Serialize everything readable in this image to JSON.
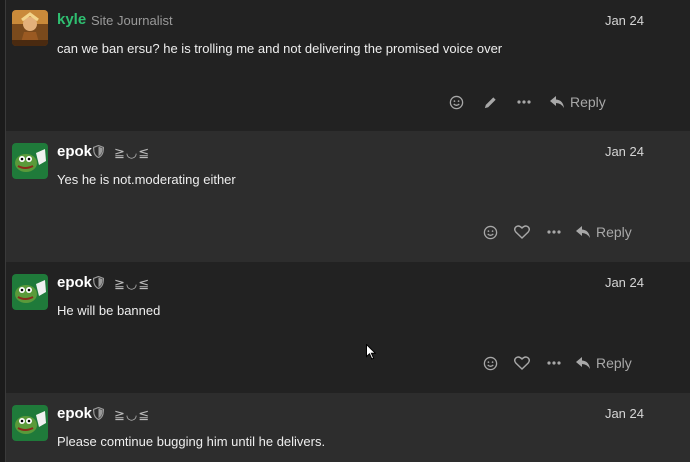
{
  "posts": [
    {
      "username": "kyle",
      "user_title": "Site Journalist",
      "date": "Jan 24",
      "text": "can we ban ersu? he is trolling me and not delivering the promised voice over",
      "reply_label": "Reply",
      "name_color": "#2fbf71",
      "actions": [
        "smile-icon",
        "edit-icon",
        "more-icon"
      ]
    },
    {
      "username": "epok",
      "emoticon": "≧◡≦",
      "date": "Jan 24",
      "text": "Yes he is not.moderating either",
      "reply_label": "Reply",
      "name_color": "#ffffff",
      "actions": [
        "smile-icon",
        "heart-icon",
        "more-icon"
      ]
    },
    {
      "username": "epok",
      "emoticon": "≧◡≦",
      "date": "Jan 24",
      "text": "He will be banned",
      "reply_label": "Reply",
      "name_color": "#ffffff",
      "actions": [
        "smile-icon",
        "heart-icon",
        "more-icon"
      ]
    },
    {
      "username": "epok",
      "emoticon": "≧◡≦",
      "date": "Jan 24",
      "text": "Please comtinue bugging him until he delivers.",
      "name_color": "#ffffff"
    }
  ],
  "colors": {
    "background": "#222222",
    "alt_background": "#2d2d2d",
    "accent": "#2fbf71"
  }
}
